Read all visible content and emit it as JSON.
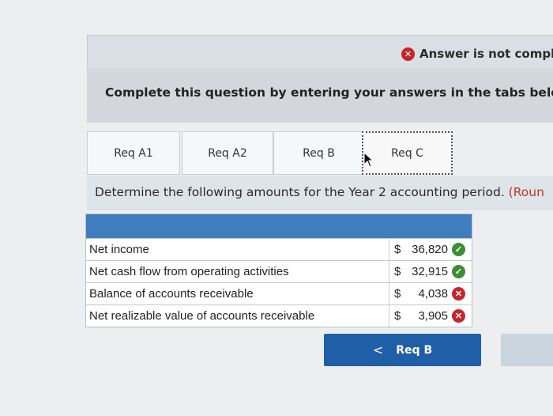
{
  "answer_status": {
    "text": "Answer is not compl",
    "icon": "x-icon"
  },
  "instruction": "Complete this question by entering your answers in the tabs belo",
  "tabs": [
    {
      "label": "Req A1"
    },
    {
      "label": "Req A2"
    },
    {
      "label": "Req B"
    },
    {
      "label": "Req C"
    }
  ],
  "prompt": {
    "text": "Determine the following amounts for the Year 2 accounting period. ",
    "hint": "(Roun"
  },
  "table": {
    "rows": [
      {
        "label": "Net income",
        "currency": "$",
        "amount": "36,820",
        "status": "correct"
      },
      {
        "label": "Net cash flow from operating activities",
        "currency": "$",
        "amount": "32,915",
        "status": "correct"
      },
      {
        "label": "Balance of accounts receivable",
        "currency": "$",
        "amount": "4,038",
        "status": "incorrect"
      },
      {
        "label": "Net realizable value of accounts receivable",
        "currency": "$",
        "amount": "3,905",
        "status": "incorrect"
      }
    ]
  },
  "nav": {
    "prev_label": "Req B",
    "prev_icon": "chevron-left-icon"
  },
  "colors": {
    "header_blue": "#3f7dbf",
    "button_blue": "#1f5fa8",
    "correct": "#3d8d35",
    "incorrect": "#c7252d"
  }
}
